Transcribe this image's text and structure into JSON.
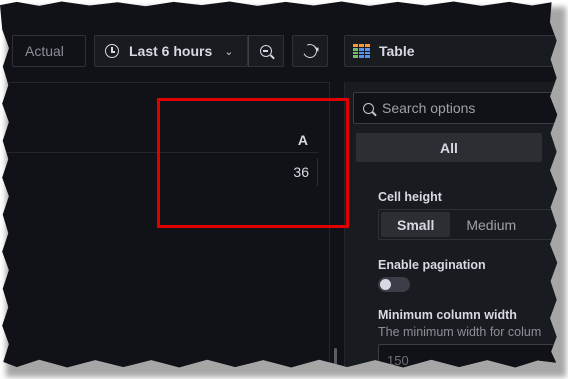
{
  "toolbar": {
    "actual_label": "Actual",
    "time_range": "Last 6 hours",
    "time_chevron": "⌄",
    "visualization": "Table"
  },
  "table": {
    "column_header": "A",
    "cell_value": "36"
  },
  "options": {
    "search_placeholder": "Search options",
    "tab_all": "All",
    "cell_height": {
      "label": "Cell height",
      "options": [
        "Small",
        "Medium"
      ],
      "selected": "Small"
    },
    "pagination": {
      "label": "Enable pagination",
      "enabled": false
    },
    "min_column_width": {
      "label": "Minimum column width",
      "description": "The minimum width for colum",
      "value": "150"
    }
  },
  "colors": {
    "background": "#111217",
    "panel": "#181b1f",
    "highlight_box": "#e00000",
    "table_icon_blue": "#5794f2",
    "table_icon_orange": "#ff9830"
  }
}
